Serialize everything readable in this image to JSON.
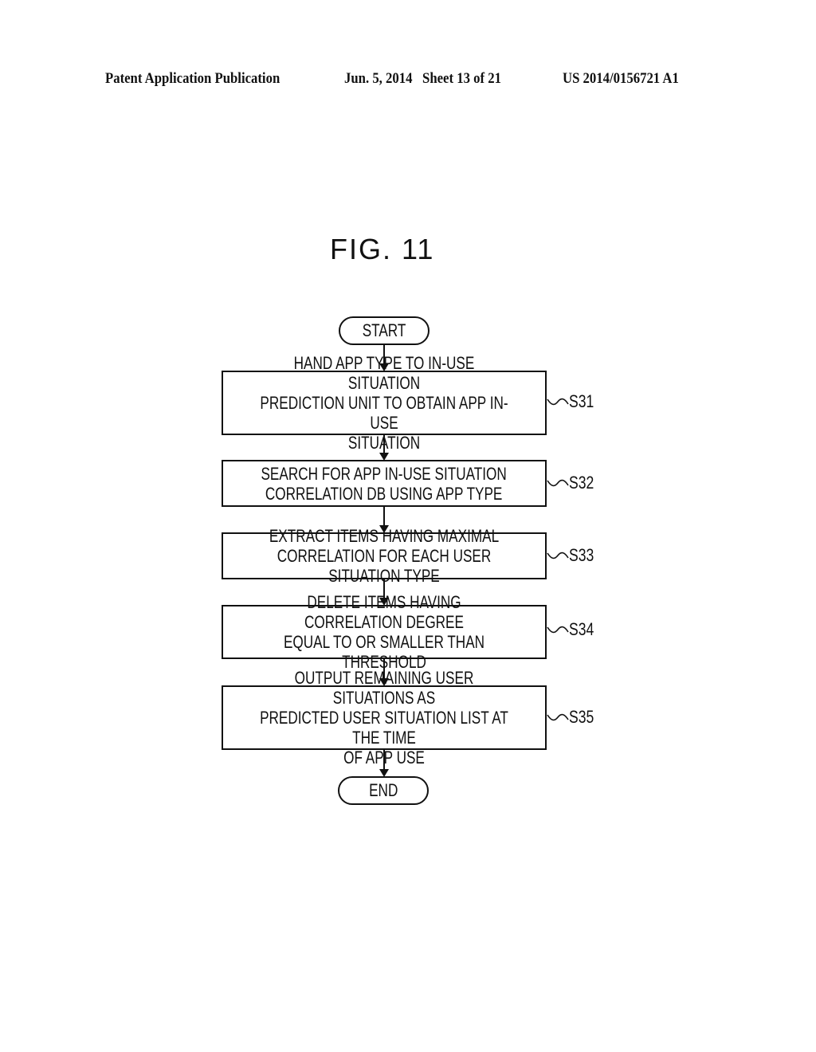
{
  "header": {
    "left": "Patent Application Publication",
    "middle": "Jun. 5, 2014   Sheet 13 of 21",
    "right": "US 2014/0156721 A1"
  },
  "figure": {
    "title": "FIG. 11",
    "start_label": "START",
    "end_label": "END",
    "steps": [
      {
        "id": "S31",
        "text": "HAND APP TYPE TO IN-USE SITUATION\nPREDICTION UNIT TO OBTAIN APP IN-USE\nSITUATION"
      },
      {
        "id": "S32",
        "text": "SEARCH FOR APP IN-USE SITUATION\nCORRELATION DB USING APP TYPE"
      },
      {
        "id": "S33",
        "text": "EXTRACT ITEMS HAVING MAXIMAL\nCORRELATION FOR EACH USER SITUATION TYPE"
      },
      {
        "id": "S34",
        "text": "DELETE ITEMS HAVING CORRELATION DEGREE\nEQUAL TO OR SMALLER THAN THRESHOLD"
      },
      {
        "id": "S35",
        "text": "OUTPUT REMAINING USER SITUATIONS AS\nPREDICTED USER SITUATION LIST AT THE TIME\nOF APP USE"
      }
    ]
  }
}
